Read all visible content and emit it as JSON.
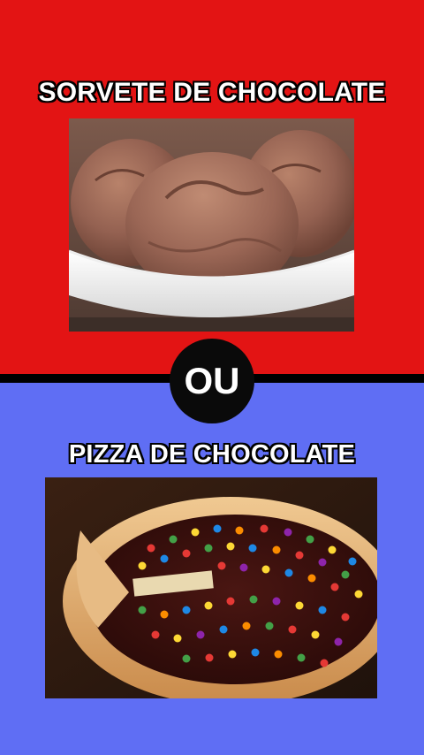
{
  "option_top": {
    "title": "SORVETE DE CHOCOLATE",
    "background_color": "#e31414",
    "image": "chocolate-ice-cream-bowl"
  },
  "separator": {
    "label": "OU"
  },
  "option_bottom": {
    "title": "PIZZA DE CHOCOLATE",
    "background_color": "#5f6ef4",
    "image": "chocolate-pizza-with-candies"
  }
}
